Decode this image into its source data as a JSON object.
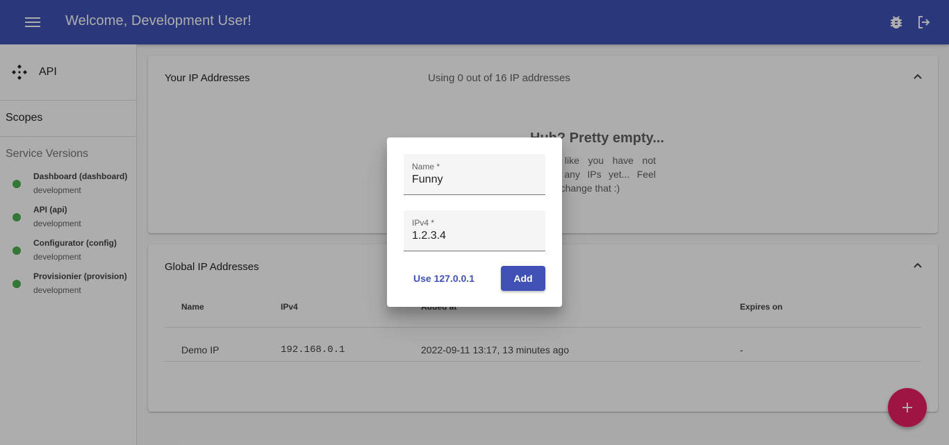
{
  "appbar": {
    "title": "Welcome, Development User!"
  },
  "sidebar": {
    "api_label": "API",
    "scopes_label": "Scopes",
    "service_versions_title": "Service Versions",
    "services": [
      {
        "name": "Dashboard (dashboard)",
        "env": "development",
        "status_color": "#4caf50"
      },
      {
        "name": "API (api)",
        "env": "development",
        "status_color": "#4caf50"
      },
      {
        "name": "Configurator (config)",
        "env": "development",
        "status_color": "#4caf50"
      },
      {
        "name": "Provisionier (provision)",
        "env": "development",
        "status_color": "#4caf50"
      }
    ]
  },
  "your_ips": {
    "title": "Your IP Addresses",
    "usage": "Using 0 out of 16 IP addresses",
    "empty_title": "Huh? Pretty empty...",
    "empty_text": "Looks like you have not added any IPs yet... Feel free to change that :)"
  },
  "global_ips": {
    "title": "Global IP Addresses",
    "columns": [
      "Name",
      "IPv4",
      "Added at",
      "Expires on"
    ],
    "rows": [
      {
        "name": "Demo IP",
        "ipv4": "192.168.0.1",
        "added": "2022-09-11 13:17, 13 minutes ago",
        "expires": "-"
      }
    ]
  },
  "dialog": {
    "name_label": "Name *",
    "name_value": "Funny",
    "ipv4_label": "IPv4 *",
    "ipv4_value": "1.2.3.4",
    "use_local_label": "Use 127.0.0.1",
    "add_label": "Add"
  },
  "colors": {
    "primary": "#3f51b5",
    "accent": "#e91e63",
    "status_ok": "#4caf50"
  },
  "icons": [
    "menu-icon",
    "bug-icon",
    "logout-icon",
    "api-icon",
    "chevron-up-icon",
    "plus-icon"
  ]
}
